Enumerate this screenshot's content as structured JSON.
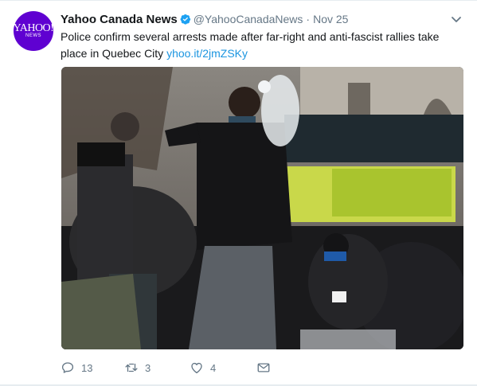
{
  "tweet": {
    "avatar": {
      "logo_main": "YAHOO!",
      "logo_sub": "NEWS"
    },
    "author_name": "Yahoo Canada News",
    "handle": "@YahooCanadaNews",
    "separator": "·",
    "date": "Nov 25",
    "text_body": "Police confirm several arrests made after far-right and anti-fascist rallies take place in Quebec City ",
    "link_text": "yhoo.it/2jmZSKy",
    "reply_count": "13",
    "retweet_count": "3",
    "like_count": "4"
  },
  "icons": {
    "verified": "verified-badge-icon",
    "caret": "chevron-down-icon",
    "reply": "reply-icon",
    "retweet": "retweet-icon",
    "like": "heart-icon",
    "message": "envelope-icon"
  },
  "colors": {
    "avatar_bg": "#5f01d1",
    "link": "#1b95e0",
    "verified": "#1da1f2",
    "muted": "#657786",
    "text": "#14171a"
  }
}
